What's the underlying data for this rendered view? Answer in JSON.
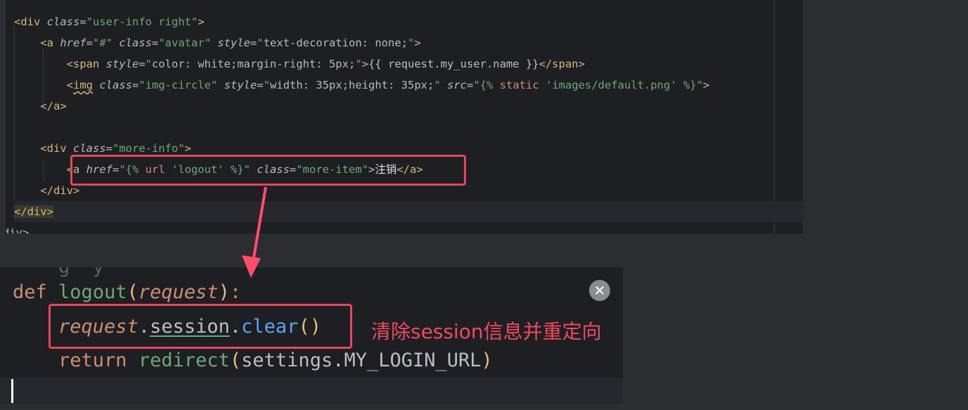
{
  "html_editor": {
    "lines": [
      {
        "indent": "",
        "parts": [
          [
            "tg",
            "<div "
          ],
          [
            "ati",
            "class"
          ],
          [
            "at",
            "="
          ],
          [
            "av",
            "\"user-info right\""
          ],
          [
            "tg",
            ">"
          ]
        ]
      },
      {
        "indent": "    ",
        "parts": [
          [
            "tg",
            "<a "
          ],
          [
            "ati",
            "href"
          ],
          [
            "at",
            "="
          ],
          [
            "av",
            "\"#\" "
          ],
          [
            "ati",
            "class"
          ],
          [
            "at",
            "="
          ],
          [
            "av",
            "\"avatar\" "
          ],
          [
            "ati",
            "style"
          ],
          [
            "at",
            "="
          ],
          [
            "av",
            "\""
          ],
          [
            "at",
            "text-decoration: none;"
          ],
          [
            "av",
            "\""
          ],
          [
            "tg",
            ">"
          ]
        ]
      },
      {
        "indent": "        ",
        "parts": [
          [
            "tg",
            "<span "
          ],
          [
            "ati",
            "style"
          ],
          [
            "at",
            "="
          ],
          [
            "av",
            "\""
          ],
          [
            "at",
            "color: white;margin-right: 5px;"
          ],
          [
            "av",
            "\""
          ],
          [
            "tg",
            ">"
          ],
          [
            "tpl",
            "{{ request.my_user.name }}"
          ],
          [
            "tg",
            "</span>"
          ]
        ]
      },
      {
        "indent": "        ",
        "parts": [
          [
            "tg",
            "<"
          ],
          [
            "tgw",
            "img"
          ],
          [
            "tg",
            " "
          ],
          [
            "ati",
            "class"
          ],
          [
            "at",
            "="
          ],
          [
            "av",
            "\"img-circle\" "
          ],
          [
            "ati",
            "style"
          ],
          [
            "at",
            "="
          ],
          [
            "av",
            "\""
          ],
          [
            "at",
            "width: 35px;height: 35px;"
          ],
          [
            "av",
            "\" "
          ],
          [
            "ati",
            "src"
          ],
          [
            "at",
            "="
          ],
          [
            "av",
            "\"{% "
          ],
          [
            "tplk",
            "static"
          ],
          [
            "av",
            " 'images/default.png' %}\""
          ],
          [
            "tg",
            ">"
          ]
        ]
      },
      {
        "indent": "    ",
        "parts": [
          [
            "tg",
            "</a>"
          ]
        ]
      },
      {
        "indent": "",
        "parts": []
      },
      {
        "indent": "    ",
        "parts": [
          [
            "tg",
            "<div "
          ],
          [
            "ati",
            "class"
          ],
          [
            "at",
            "="
          ],
          [
            "av",
            "\"more-info\""
          ],
          [
            "tg",
            ">"
          ]
        ]
      },
      {
        "indent": "        ",
        "parts": [
          [
            "tg",
            "<a "
          ],
          [
            "ati",
            "href"
          ],
          [
            "at",
            "="
          ],
          [
            "av",
            "\"{% "
          ],
          [
            "tplk",
            "url"
          ],
          [
            "av",
            " 'logout' %}\" "
          ],
          [
            "ati",
            "class"
          ],
          [
            "at",
            "="
          ],
          [
            "av",
            "\"more-item\""
          ],
          [
            "tg",
            ">"
          ],
          [
            "cjk",
            "注销"
          ],
          [
            "tg",
            "</a>"
          ]
        ]
      },
      {
        "indent": "    ",
        "parts": [
          [
            "tg",
            "</div>"
          ]
        ]
      },
      {
        "indent": "",
        "parts": [
          [
            "tgm",
            "</div>"
          ]
        ]
      },
      {
        "indent": "",
        "parts": [
          [
            "at",
            "div>"
          ]
        ]
      }
    ]
  },
  "python_editor": {
    "line0": "    g  y",
    "def_kw": "def",
    "func_name": "logout",
    "param": "request",
    "line2_obj": "request",
    "line2_attr": "session",
    "line2_method": "clear",
    "return_kw": "return",
    "redirect_fn": "redirect",
    "settings_obj": "settings",
    "setting_name": "MY_LOGIN_URL"
  },
  "close_icon": "close-icon",
  "annotation": {
    "note_text": "清除session信息并重定向",
    "color": "#e8475a"
  }
}
